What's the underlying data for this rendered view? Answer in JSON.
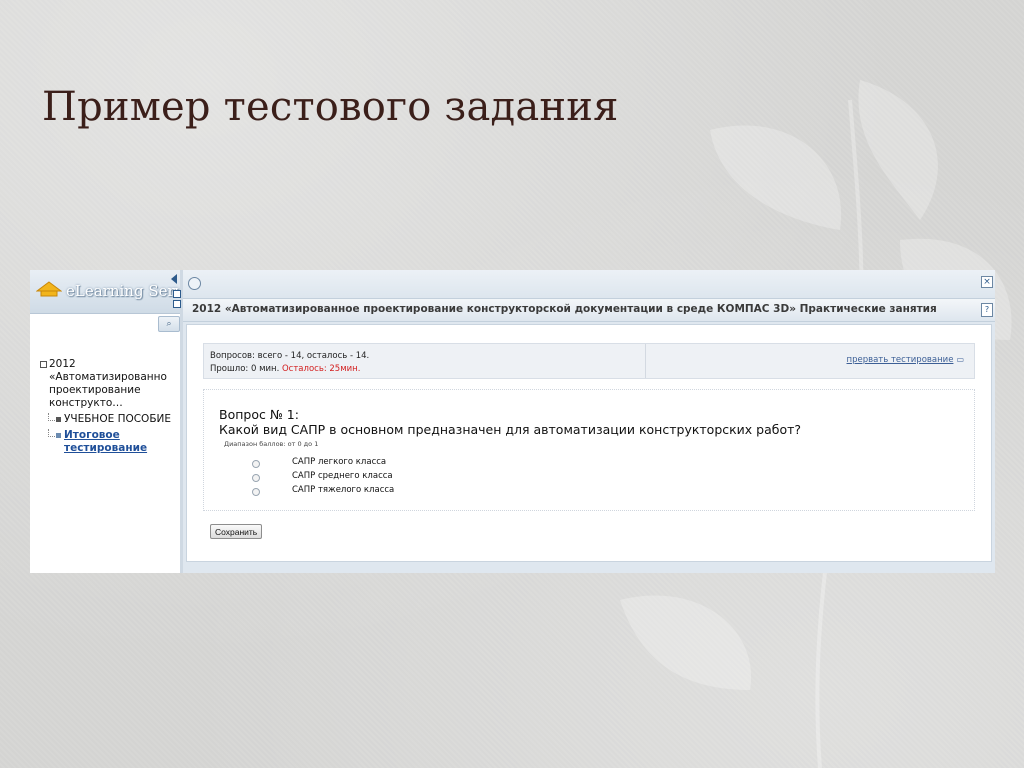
{
  "slide": {
    "title": "Пример тестового задания"
  },
  "app": {
    "logo_text": "eLearning Serv"
  },
  "sidebar": {
    "tree": {
      "root_label": "2012 «Автоматизированно проектирование конструкто…",
      "children": [
        {
          "label": "УЧЕБНОЕ ПОСОБИЕ"
        },
        {
          "label": "Итоговое тестирование"
        }
      ]
    }
  },
  "course": {
    "title": "2012 «Автоматизированное проектирование конструкторской документации в среде КОМПАС 3D» Практические занятия"
  },
  "test_info": {
    "questions_line": "Вопросов: всего - 14, осталось - 14.",
    "elapsed": "Прошло: 0 мин.",
    "remaining": "Осталось: 25мин.",
    "abort_link": "прервать тестирование"
  },
  "question": {
    "number": "Вопрос № 1:",
    "text": "Какой вид САПР в основном предназначен для автоматизации конструкторских работ?",
    "range": "Диапазон баллов: от 0 до 1",
    "options": [
      {
        "label": "САПР легкого класса"
      },
      {
        "label": "САПР среднего класса"
      },
      {
        "label": "САПР тяжелого класса"
      }
    ]
  },
  "actions": {
    "save_label": "Сохранить"
  },
  "colors": {
    "title": "#3b1f1a",
    "remaining_text": "#d32020",
    "link": "#1f4f99"
  },
  "icons": [
    "home-icon",
    "search-icon",
    "collapse-arrow-icon",
    "refresh-icon",
    "close-icon",
    "help-icon",
    "comment-icon"
  ]
}
